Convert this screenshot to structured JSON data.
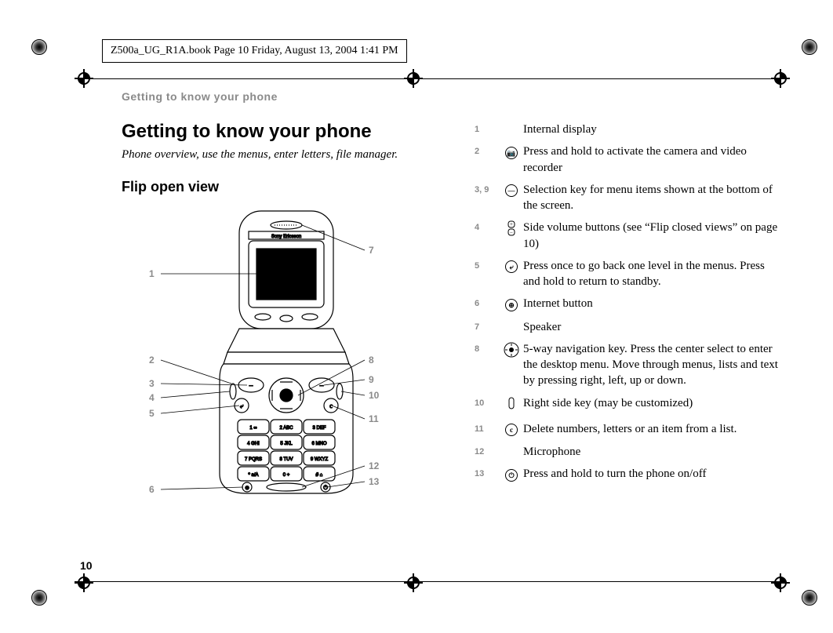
{
  "meta": {
    "header_line": "Z500a_UG_R1A.book  Page 10  Friday, August 13, 2004  1:41 PM",
    "running_head": "Getting to know your phone",
    "page_number": "10"
  },
  "left": {
    "title": "Getting to know your phone",
    "subtitle": "Phone overview, use the menus, enter letters, file manager.",
    "section": "Flip open view",
    "callouts": [
      "1",
      "2",
      "3",
      "4",
      "5",
      "6",
      "7",
      "8",
      "9",
      "10",
      "11",
      "12",
      "13"
    ],
    "phone_brand": "Sony Ericsson",
    "keypad": [
      "1",
      "2 ABC",
      "3 DEF",
      "4 GHI",
      "5 JKL",
      "6 MNO",
      "7 PQRS",
      "8 TUV",
      "9 WXYZ",
      "*",
      "0 +",
      "#"
    ]
  },
  "legend": [
    {
      "num": "1",
      "icon": "",
      "desc": "Internal display"
    },
    {
      "num": "2",
      "icon": "camera",
      "desc": "Press and hold to activate the camera and video recorder"
    },
    {
      "num": "3, 9",
      "icon": "selkey",
      "desc": "Selection key for menu items shown at the bottom of the screen."
    },
    {
      "num": "4",
      "icon": "volume",
      "desc": "Side volume buttons (see “Flip closed views” on page 10)"
    },
    {
      "num": "5",
      "icon": "back",
      "desc": "Press once to go back one level in the menus. Press and hold to return to standby."
    },
    {
      "num": "6",
      "icon": "globe",
      "desc": "Internet button"
    },
    {
      "num": "7",
      "icon": "",
      "desc": "Speaker"
    },
    {
      "num": "8",
      "icon": "nav",
      "desc": "5-way navigation key. Press the center select to enter the desktop menu. Move through menus, lists and text by pressing right, left, up or down."
    },
    {
      "num": "10",
      "icon": "sidekey",
      "desc": "Right side key (may be customized)"
    },
    {
      "num": "11",
      "icon": "clear",
      "desc": "Delete numbers, letters or an item from a list."
    },
    {
      "num": "12",
      "icon": "",
      "desc": "Microphone"
    },
    {
      "num": "13",
      "icon": "power",
      "desc": "Press and hold to turn the phone on/off"
    }
  ]
}
